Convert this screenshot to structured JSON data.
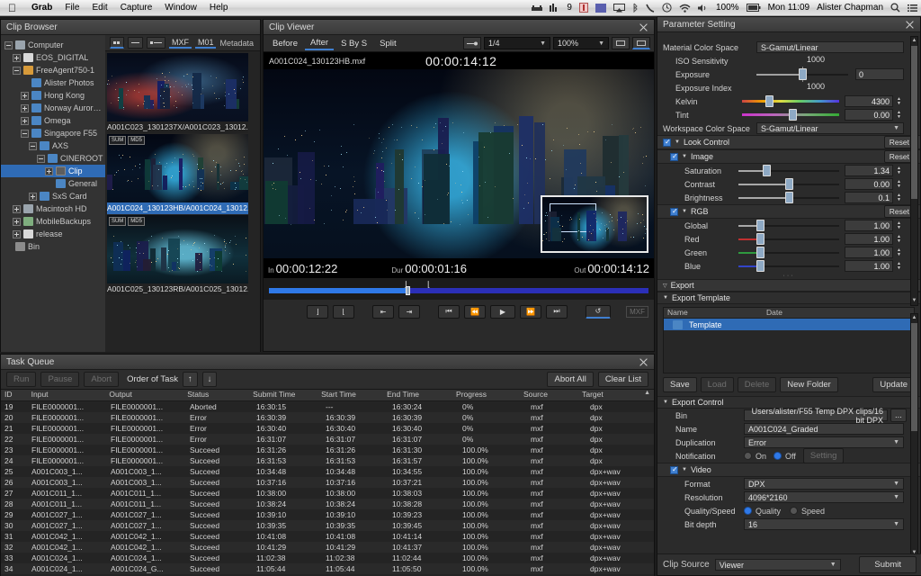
{
  "menubar": {
    "apple": "apple-logo",
    "items": [
      "Grab",
      "File",
      "Edit",
      "Capture",
      "Window",
      "Help"
    ],
    "status": {
      "battery": "100%",
      "clock": "Mon 11:09",
      "user": "Alister Chapman",
      "badge_count": "9"
    }
  },
  "clip_browser": {
    "title": "Clip Browser",
    "tree": [
      {
        "label": "Computer",
        "depth": 0,
        "twist": "minus",
        "icon": "disk",
        "selected": false
      },
      {
        "label": "EOS_DIGITAL",
        "depth": 1,
        "twist": "plus",
        "icon": "disk-w",
        "selected": false
      },
      {
        "label": "FreeAgent750-1",
        "depth": 1,
        "twist": "minus",
        "icon": "folder-o",
        "selected": false
      },
      {
        "label": "Alister Photos",
        "depth": 2,
        "twist": "none",
        "icon": "folder",
        "selected": false
      },
      {
        "label": "Hong Kong",
        "depth": 2,
        "twist": "plus",
        "icon": "folder",
        "selected": false
      },
      {
        "label": "Norway Aurora Pr",
        "depth": 2,
        "twist": "plus",
        "icon": "folder",
        "selected": false
      },
      {
        "label": "Omega",
        "depth": 2,
        "twist": "plus",
        "icon": "folder",
        "selected": false
      },
      {
        "label": "Singapore F55",
        "depth": 2,
        "twist": "minus",
        "icon": "folder",
        "selected": false
      },
      {
        "label": "AXS",
        "depth": 3,
        "twist": "minus",
        "icon": "folder",
        "selected": false
      },
      {
        "label": "CINEROOT",
        "depth": 4,
        "twist": "minus",
        "icon": "folder",
        "selected": false
      },
      {
        "label": "Clip",
        "depth": 5,
        "twist": "plus",
        "icon": "mxf",
        "selected": true
      },
      {
        "label": "General",
        "depth": 5,
        "twist": "none",
        "icon": "folder",
        "selected": false
      },
      {
        "label": "SxS Card",
        "depth": 3,
        "twist": "plus",
        "icon": "folder",
        "selected": false
      },
      {
        "label": "Macintosh HD",
        "depth": 1,
        "twist": "plus",
        "icon": "disk",
        "selected": false
      },
      {
        "label": "MobileBackups",
        "depth": 1,
        "twist": "plus",
        "icon": "disk-g",
        "selected": false
      },
      {
        "label": "release",
        "depth": 1,
        "twist": "plus",
        "icon": "disk-w",
        "selected": false
      },
      {
        "label": "Bin",
        "depth": 0,
        "twist": "none",
        "icon": "bin",
        "selected": false
      }
    ],
    "toolbar": {
      "mxf_label": "MXF",
      "m01_label": "M01",
      "metadata_label": "Metadata"
    },
    "thumbnails": [
      {
        "caption": "A001C023_1301237X/A001C023_13012...",
        "selected": false,
        "badges": []
      },
      {
        "caption": "A001C024_130123HB/A001C024_13012...",
        "selected": true,
        "badges": [
          "SUM",
          "MD5"
        ]
      },
      {
        "caption": "A001C025_130123RB/A001C025_13012...",
        "selected": false,
        "badges": [
          "SUM",
          "MD5"
        ]
      }
    ]
  },
  "clip_viewer": {
    "title": "Clip Viewer",
    "tabs": [
      {
        "label": "Before",
        "active": false
      },
      {
        "label": "After",
        "active": true
      },
      {
        "label": "S By S",
        "active": false
      },
      {
        "label": "Split",
        "active": false
      }
    ],
    "scale": "1/4",
    "zoom": "100%",
    "clip_name": "A001C024_130123HB.mxf",
    "timecode": "00:00:14:12",
    "in_label": "In",
    "in_value": "00:00:12:22",
    "dur_label": "Dur",
    "dur_value": "00:00:01:16",
    "out_label": "Out",
    "out_value": "00:00:14:12",
    "format_tag": "MXF"
  },
  "task_queue": {
    "title": "Task Queue",
    "buttons": {
      "run": "Run",
      "pause": "Pause",
      "abort": "Abort",
      "order_of_task": "Order of Task",
      "abort_all": "Abort All",
      "clear_list": "Clear List"
    },
    "columns": [
      "ID",
      "Input",
      "Output",
      "Status",
      "Submit Time",
      "Start Time",
      "End Time",
      "Progress",
      "Source",
      "Target"
    ],
    "rows": [
      [
        "19",
        "FILE0000001...",
        "FILE0000001...",
        "Aborted",
        "16:30:15",
        "---",
        "16:30:24",
        "0%",
        "mxf",
        "dpx"
      ],
      [
        "20",
        "FILE0000001...",
        "FILE0000001...",
        "Error",
        "16:30:39",
        "16:30:39",
        "16:30:39",
        "0%",
        "mxf",
        "dpx"
      ],
      [
        "21",
        "FILE0000001...",
        "FILE0000001...",
        "Error",
        "16:30:40",
        "16:30:40",
        "16:30:40",
        "0%",
        "mxf",
        "dpx"
      ],
      [
        "22",
        "FILE0000001...",
        "FILE0000001...",
        "Error",
        "16:31:07",
        "16:31:07",
        "16:31:07",
        "0%",
        "mxf",
        "dpx"
      ],
      [
        "23",
        "FILE0000001...",
        "FILE0000001...",
        "Succeed",
        "16:31:26",
        "16:31:26",
        "16:31:30",
        "100.0%",
        "mxf",
        "dpx"
      ],
      [
        "24",
        "FILE0000001...",
        "FILE0000001...",
        "Succeed",
        "16:31:53",
        "16:31:53",
        "16:31:57",
        "100.0%",
        "mxf",
        "dpx"
      ],
      [
        "25",
        "A001C003_1...",
        "A001C003_1...",
        "Succeed",
        "10:34:48",
        "10:34:48",
        "10:34:55",
        "100.0%",
        "mxf",
        "dpx+wav"
      ],
      [
        "26",
        "A001C003_1...",
        "A001C003_1...",
        "Succeed",
        "10:37:16",
        "10:37:16",
        "10:37:21",
        "100.0%",
        "mxf",
        "dpx+wav"
      ],
      [
        "27",
        "A001C011_1...",
        "A001C011_1...",
        "Succeed",
        "10:38:00",
        "10:38:00",
        "10:38:03",
        "100.0%",
        "mxf",
        "dpx+wav"
      ],
      [
        "28",
        "A001C011_1...",
        "A001C011_1...",
        "Succeed",
        "10:38:24",
        "10:38:24",
        "10:38:28",
        "100.0%",
        "mxf",
        "dpx+wav"
      ],
      [
        "29",
        "A001C027_1...",
        "A001C027_1...",
        "Succeed",
        "10:39:10",
        "10:39:10",
        "10:39:23",
        "100.0%",
        "mxf",
        "dpx+wav"
      ],
      [
        "30",
        "A001C027_1...",
        "A001C027_1...",
        "Succeed",
        "10:39:35",
        "10:39:35",
        "10:39:45",
        "100.0%",
        "mxf",
        "dpx+wav"
      ],
      [
        "31",
        "A001C042_1...",
        "A001C042_1...",
        "Succeed",
        "10:41:08",
        "10:41:08",
        "10:41:14",
        "100.0%",
        "mxf",
        "dpx+wav"
      ],
      [
        "32",
        "A001C042_1...",
        "A001C042_1...",
        "Succeed",
        "10:41:29",
        "10:41:29",
        "10:41:37",
        "100.0%",
        "mxf",
        "dpx+wav"
      ],
      [
        "33",
        "A001C024_1...",
        "A001C024_1...",
        "Succeed",
        "11:02:38",
        "11:02:38",
        "11:02:44",
        "100.0%",
        "mxf",
        "dpx+wav"
      ],
      [
        "34",
        "A001C024_1...",
        "A001C024_G...",
        "Succeed",
        "11:05:44",
        "11:05:44",
        "11:05:50",
        "100.0%",
        "mxf",
        "dpx+wav"
      ]
    ]
  },
  "parameter": {
    "title": "Parameter Setting",
    "material_color_space": {
      "label": "Material Color Space",
      "value": "S-Gamut/Linear"
    },
    "iso_sensitivity": {
      "label": "ISO Sensitivity",
      "value": "1000"
    },
    "exposure": {
      "label": "Exposure",
      "value": "0"
    },
    "exposure_index": {
      "label": "Exposure Index",
      "value": "1000"
    },
    "kelvin": {
      "label": "Kelvin",
      "value": "4300"
    },
    "tint": {
      "label": "Tint",
      "value": "0.00"
    },
    "workspace_color_space": {
      "label": "Workspace Color Space",
      "value": "S-Gamut/Linear"
    },
    "look_control": {
      "label": "Look Control",
      "reset": "Reset"
    },
    "image": {
      "label": "Image",
      "reset": "Reset",
      "rows": [
        {
          "label": "Saturation",
          "value": "1.34",
          "pos": 28
        },
        {
          "label": "Contrast",
          "value": "0.00",
          "pos": 50
        },
        {
          "label": "Brightness",
          "value": "0.1",
          "pos": 50
        }
      ]
    },
    "rgb": {
      "label": "RGB",
      "reset": "Reset",
      "rows": [
        {
          "label": "Global",
          "value": "1.00",
          "color": "#a8a8a8",
          "pos": 21
        },
        {
          "label": "Red",
          "value": "1.00",
          "color": "#c03030",
          "pos": 21
        },
        {
          "label": "Green",
          "value": "1.00",
          "color": "#2f9a3f",
          "pos": 21
        },
        {
          "label": "Blue",
          "value": "1.00",
          "color": "#3344c8",
          "pos": 21
        }
      ]
    },
    "export": {
      "label": "Export"
    },
    "export_template": {
      "label": "Export Template",
      "columns": [
        "Name",
        "Date"
      ],
      "row": "Template",
      "buttons": {
        "save": "Save",
        "load": "Load",
        "delete": "Delete",
        "new_folder": "New Folder",
        "update": "Update"
      }
    },
    "export_control": {
      "label": "Export Control",
      "bin": {
        "label": "Bin",
        "value": "Users/alister/F55 Temp DPX clips/16 bit DPX",
        "browse": "..."
      },
      "name": {
        "label": "Name",
        "value": "A001C024_Graded"
      },
      "duplication": {
        "label": "Duplication",
        "value": "Error"
      },
      "notification": {
        "label": "Notification",
        "on": "On",
        "off": "Off",
        "setting": "Setting",
        "selected": "Off"
      }
    },
    "video": {
      "label": "Video",
      "format": {
        "label": "Format",
        "value": "DPX"
      },
      "resolution": {
        "label": "Resolution",
        "value": "4096*2160"
      },
      "quality_speed": {
        "label": "Quality/Speed",
        "quality": "Quality",
        "speed": "Speed",
        "selected": "Quality"
      },
      "bit_depth": {
        "label": "Bit depth",
        "value": "16"
      }
    },
    "clip_source": {
      "label": "Clip Source",
      "value": "Viewer",
      "submit": "Submit"
    }
  },
  "colors": {
    "accent": "#3f7fd0",
    "selection": "#2f6bb5",
    "panel_bg": "#2a2a2a"
  }
}
